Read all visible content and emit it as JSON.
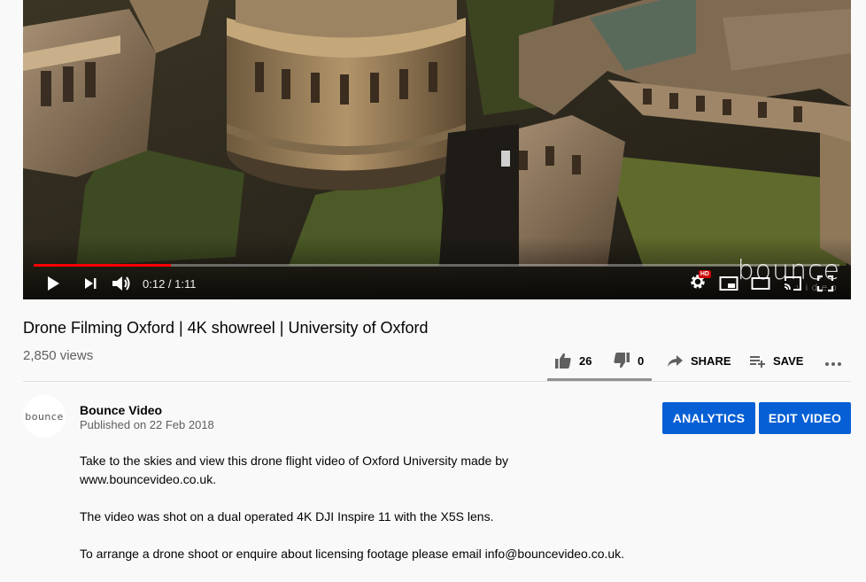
{
  "player": {
    "progress_fraction": 0.17,
    "current_time": "0:12",
    "duration": "1:11",
    "time_display": "0:12 / 1:11",
    "watermark": "bounce",
    "watermark_sub": "video",
    "hd_badge": "HD",
    "accent_color": "#ff0000"
  },
  "video": {
    "title": "Drone Filming Oxford | 4K showreel | University of Oxford",
    "views": "2,850 views"
  },
  "actions": {
    "like_count": "26",
    "dislike_count": "0",
    "share_label": "SHARE",
    "save_label": "SAVE"
  },
  "channel": {
    "avatar_text": "bounce",
    "name": "Bounce Video",
    "published": "Published on 22 Feb 2018"
  },
  "buttons": {
    "analytics": "ANALYTICS",
    "edit_video": "EDIT VIDEO",
    "color": "#065fd4"
  },
  "description": {
    "p1": "Take to the skies and view this drone flight video of Oxford University made by www.bouncevideo.co.uk.",
    "p2": "The video was shot on a dual operated 4K DJI Inspire 11 with the X5S lens.",
    "p3": "To arrange a drone shoot or enquire about licensing footage please email info@bouncevideo.co.uk."
  }
}
